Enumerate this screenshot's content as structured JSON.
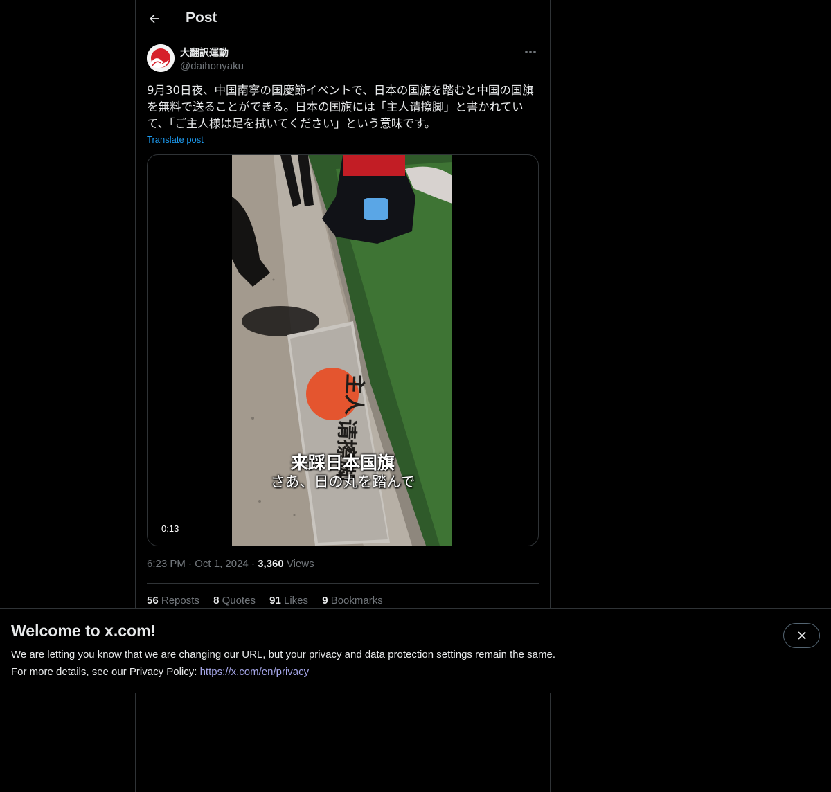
{
  "header": {
    "title": "Post",
    "back_icon": "arrow-left-icon"
  },
  "post": {
    "author": {
      "display_name": "大翻訳運動",
      "handle": "@daihonyaku"
    },
    "text": "9月30日夜、中国南寧の国慶節イベントで、日本の国旗を踏むと中国の国旗を無料で送ることができる。日本の国旗には「主人请擦脚」と書かれていて、「ご主人様は足を拭いてください」という意味です。",
    "translate_label": "Translate post",
    "media": {
      "type": "video",
      "subtitle_line1": "来踩日本国旗",
      "subtitle_line2": "さあ、日の丸を踏んで",
      "duration": "0:13",
      "flag_text_top": "主人",
      "flag_text_bottom": "请擦脚"
    },
    "time": "6:23 PM",
    "date": "Oct 1, 2024",
    "views_count": "3,360",
    "views_label": "Views",
    "stats": {
      "reposts_count": "56",
      "reposts_label": "Reposts",
      "quotes_count": "8",
      "quotes_label": "Quotes",
      "likes_count": "91",
      "likes_label": "Likes",
      "bookmarks_count": "9",
      "bookmarks_label": "Bookmarks"
    }
  },
  "banner": {
    "title": "Welcome to x.com!",
    "line1": "We are letting you know that we are changing our URL, but your privacy and data protection settings remain the same.",
    "line2_prefix": "For more details, see our Privacy Policy: ",
    "link_text": "https://x.com/en/privacy",
    "close_icon": "close-icon"
  },
  "colors": {
    "background": "#000000",
    "text_primary": "#e7e9ea",
    "text_secondary": "#71767b",
    "accent": "#1d9bf0",
    "border": "#2f3336",
    "link": "#a5a6e8"
  }
}
